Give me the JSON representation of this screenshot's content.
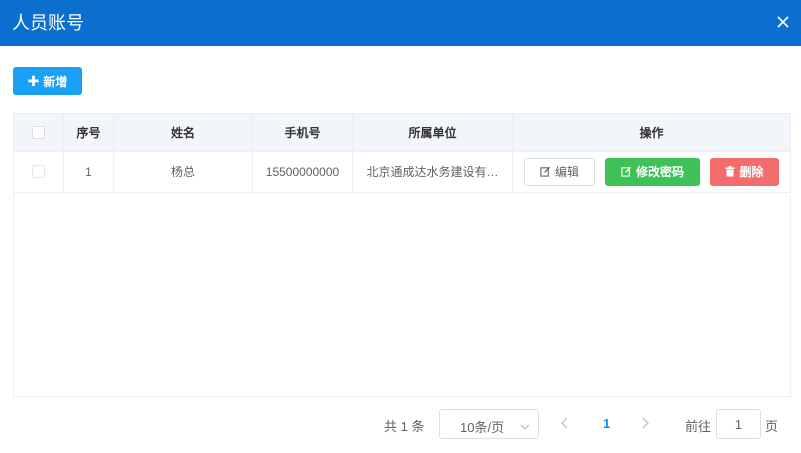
{
  "dialog": {
    "title": "人员账号"
  },
  "toolbar": {
    "add_label": "新增"
  },
  "table": {
    "headers": [
      "序号",
      "姓名",
      "手机号",
      "所属单位",
      "操作"
    ],
    "rows": [
      {
        "index": "1",
        "name": "杨总",
        "phone": "15500000000",
        "unit": "北京通成达水务建设有…",
        "actions": {
          "edit": "编辑",
          "change_password": "修改密码",
          "delete": "删除"
        }
      }
    ]
  },
  "pagination": {
    "total": "共 1 条",
    "page_size": "10条/页",
    "current_page": "1",
    "goto_label": "前往",
    "goto_value": "1",
    "goto_suffix": "页"
  },
  "colors": {
    "header_bg": "#0b6fcf",
    "add_button": "#1aa0f5",
    "change_password_button": "#3ec157",
    "delete_button": "#f36d6d",
    "current_page": "#1989fa"
  },
  "icons": [
    "close-icon",
    "plus-icon",
    "edit-icon",
    "trash-icon",
    "chevron-down-icon",
    "chevron-left-icon",
    "chevron-right-icon"
  ]
}
